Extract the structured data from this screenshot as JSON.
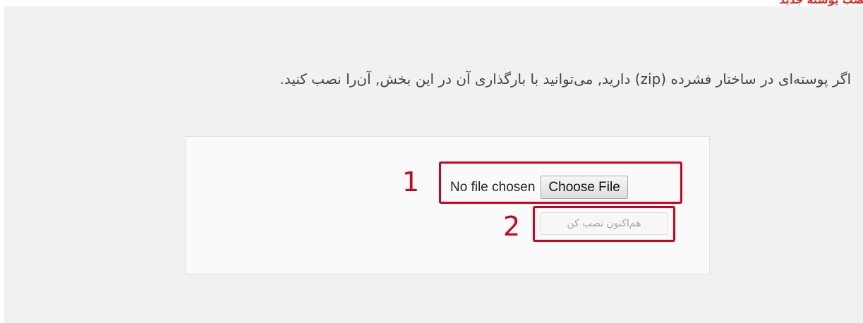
{
  "header": {
    "clipped_title": "نصب پوسته جدید"
  },
  "intro": {
    "text": "اگر پوسته‌ای در ساختار فشرده (zip) دارید, می‌توانید با بارگذاری آن در این بخش, آن‌را نصب کنید."
  },
  "upload": {
    "file_status": "No file chosen",
    "choose_label": "Choose File",
    "install_label": "هم‌اکنون نصب کن"
  },
  "annotations": {
    "step_1": "1",
    "step_2": "2"
  },
  "colors": {
    "highlight": "#d0021b",
    "panel_bg": "#f1f1f1",
    "box_bg": "#fafafa"
  }
}
